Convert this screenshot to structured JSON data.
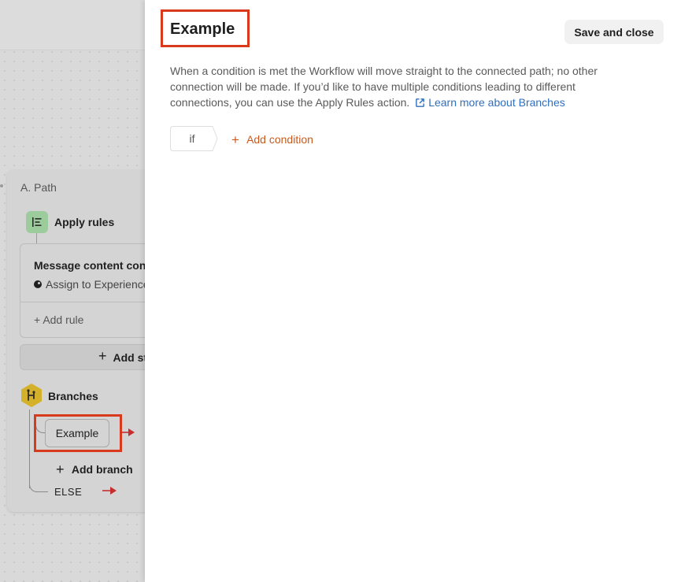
{
  "canvas": {
    "path": {
      "label": "A. Path",
      "apply_rules": {
        "title": "Apply rules",
        "rule_title": "Message content contains",
        "rule_action": "Assign to Experience",
        "add_rule_label": "Add rule"
      },
      "add_step_label": "Add step",
      "branches": {
        "title": "Branches",
        "items": [
          {
            "label": "Example"
          }
        ],
        "add_branch_label": "Add branch",
        "else_label": "ELSE"
      }
    }
  },
  "panel": {
    "title": "Example",
    "save_label": "Save and close",
    "description": "When a condition is met the Workflow will move straight to the connected path; no other connection will be made. If you’d like to have multiple conditions leading to different connections, you can use the Apply Rules action.",
    "learn_more_label": "Learn more about Branches",
    "if_label": "if",
    "add_condition_label": "Add condition"
  },
  "colors": {
    "highlight": "#d9391c",
    "link": "#2f6fbf",
    "add_condition": "#c95a1c",
    "rules_icon_bg": "#9ccc9c",
    "branches_icon_bg": "#d4b12a",
    "arrow": "#c62f2f"
  },
  "icons": {
    "apply_rules": "rules-list-icon",
    "branches": "branches-hexagon-icon",
    "external_link": "external-link-icon",
    "arrow": "arrow-right-icon"
  }
}
